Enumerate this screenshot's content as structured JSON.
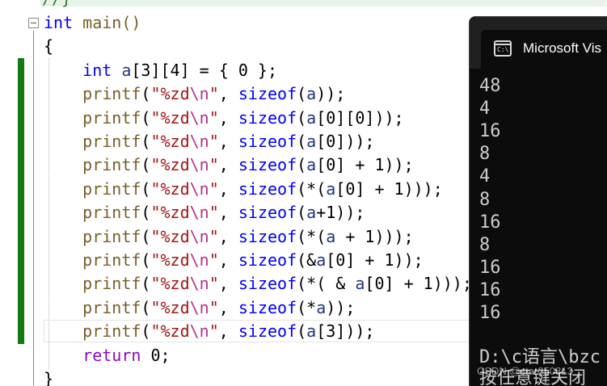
{
  "editor": {
    "top_fragment": "//}",
    "lines": [
      {
        "tokens": [
          {
            "t": "int",
            "c": "kw"
          },
          {
            "t": " main()",
            "c": "fn"
          }
        ]
      },
      {
        "tokens": [
          {
            "t": "{",
            "c": "pl"
          }
        ]
      },
      {
        "tokens": [
          {
            "t": "    ",
            "c": "pl"
          },
          {
            "t": "int",
            "c": "kw"
          },
          {
            "t": " ",
            "c": "pl"
          },
          {
            "t": "a",
            "c": "var"
          },
          {
            "t": "[3][4] = { 0 };",
            "c": "pl"
          }
        ]
      },
      {
        "tokens": [
          {
            "t": "    ",
            "c": "pl"
          },
          {
            "t": "printf",
            "c": "fn"
          },
          {
            "t": "(",
            "c": "pl"
          },
          {
            "t": "\"%zd",
            "c": "str"
          },
          {
            "t": "\\n",
            "c": "esc"
          },
          {
            "t": "\"",
            "c": "str"
          },
          {
            "t": ", ",
            "c": "pl"
          },
          {
            "t": "sizeof",
            "c": "kw"
          },
          {
            "t": "(",
            "c": "pl"
          },
          {
            "t": "a",
            "c": "var"
          },
          {
            "t": "));",
            "c": "pl"
          }
        ]
      },
      {
        "tokens": [
          {
            "t": "    ",
            "c": "pl"
          },
          {
            "t": "printf",
            "c": "fn"
          },
          {
            "t": "(",
            "c": "pl"
          },
          {
            "t": "\"%zd",
            "c": "str"
          },
          {
            "t": "\\n",
            "c": "esc"
          },
          {
            "t": "\"",
            "c": "str"
          },
          {
            "t": ", ",
            "c": "pl"
          },
          {
            "t": "sizeof",
            "c": "kw"
          },
          {
            "t": "(",
            "c": "pl"
          },
          {
            "t": "a",
            "c": "var"
          },
          {
            "t": "[0][0]));",
            "c": "pl"
          }
        ]
      },
      {
        "tokens": [
          {
            "t": "    ",
            "c": "pl"
          },
          {
            "t": "printf",
            "c": "fn"
          },
          {
            "t": "(",
            "c": "pl"
          },
          {
            "t": "\"%zd",
            "c": "str"
          },
          {
            "t": "\\n",
            "c": "esc"
          },
          {
            "t": "\"",
            "c": "str"
          },
          {
            "t": ", ",
            "c": "pl"
          },
          {
            "t": "sizeof",
            "c": "kw"
          },
          {
            "t": "(",
            "c": "pl"
          },
          {
            "t": "a",
            "c": "var"
          },
          {
            "t": "[0]));",
            "c": "pl"
          }
        ]
      },
      {
        "tokens": [
          {
            "t": "    ",
            "c": "pl"
          },
          {
            "t": "printf",
            "c": "fn"
          },
          {
            "t": "(",
            "c": "pl"
          },
          {
            "t": "\"%zd",
            "c": "str"
          },
          {
            "t": "\\n",
            "c": "esc"
          },
          {
            "t": "\"",
            "c": "str"
          },
          {
            "t": ", ",
            "c": "pl"
          },
          {
            "t": "sizeof",
            "c": "kw"
          },
          {
            "t": "(",
            "c": "pl"
          },
          {
            "t": "a",
            "c": "var"
          },
          {
            "t": "[0] + 1));",
            "c": "pl"
          }
        ]
      },
      {
        "tokens": [
          {
            "t": "    ",
            "c": "pl"
          },
          {
            "t": "printf",
            "c": "fn"
          },
          {
            "t": "(",
            "c": "pl"
          },
          {
            "t": "\"%zd",
            "c": "str"
          },
          {
            "t": "\\n",
            "c": "esc"
          },
          {
            "t": "\"",
            "c": "str"
          },
          {
            "t": ", ",
            "c": "pl"
          },
          {
            "t": "sizeof",
            "c": "kw"
          },
          {
            "t": "(*(",
            "c": "pl"
          },
          {
            "t": "a",
            "c": "var"
          },
          {
            "t": "[0] + 1)));",
            "c": "pl"
          }
        ]
      },
      {
        "tokens": [
          {
            "t": "    ",
            "c": "pl"
          },
          {
            "t": "printf",
            "c": "fn"
          },
          {
            "t": "(",
            "c": "pl"
          },
          {
            "t": "\"%zd",
            "c": "str"
          },
          {
            "t": "\\n",
            "c": "esc"
          },
          {
            "t": "\"",
            "c": "str"
          },
          {
            "t": ", ",
            "c": "pl"
          },
          {
            "t": "sizeof",
            "c": "kw"
          },
          {
            "t": "(",
            "c": "pl"
          },
          {
            "t": "a",
            "c": "var"
          },
          {
            "t": "+1));",
            "c": "pl"
          }
        ]
      },
      {
        "tokens": [
          {
            "t": "    ",
            "c": "pl"
          },
          {
            "t": "printf",
            "c": "fn"
          },
          {
            "t": "(",
            "c": "pl"
          },
          {
            "t": "\"%zd",
            "c": "str"
          },
          {
            "t": "\\n",
            "c": "esc"
          },
          {
            "t": "\"",
            "c": "str"
          },
          {
            "t": ", ",
            "c": "pl"
          },
          {
            "t": "sizeof",
            "c": "kw"
          },
          {
            "t": "(*(",
            "c": "pl"
          },
          {
            "t": "a",
            "c": "var"
          },
          {
            "t": " + 1)));",
            "c": "pl"
          }
        ]
      },
      {
        "tokens": [
          {
            "t": "    ",
            "c": "pl"
          },
          {
            "t": "printf",
            "c": "fn"
          },
          {
            "t": "(",
            "c": "pl"
          },
          {
            "t": "\"%zd",
            "c": "str"
          },
          {
            "t": "\\n",
            "c": "esc"
          },
          {
            "t": "\"",
            "c": "str"
          },
          {
            "t": ", ",
            "c": "pl"
          },
          {
            "t": "sizeof",
            "c": "kw"
          },
          {
            "t": "(&",
            "c": "pl"
          },
          {
            "t": "a",
            "c": "var"
          },
          {
            "t": "[0] + 1));",
            "c": "pl"
          }
        ]
      },
      {
        "tokens": [
          {
            "t": "    ",
            "c": "pl"
          },
          {
            "t": "printf",
            "c": "fn"
          },
          {
            "t": "(",
            "c": "pl"
          },
          {
            "t": "\"%zd",
            "c": "str"
          },
          {
            "t": "\\n",
            "c": "esc"
          },
          {
            "t": "\"",
            "c": "str"
          },
          {
            "t": ", ",
            "c": "pl"
          },
          {
            "t": "sizeof",
            "c": "kw"
          },
          {
            "t": "(*( & ",
            "c": "pl"
          },
          {
            "t": "a",
            "c": "var"
          },
          {
            "t": "[0] + 1)));",
            "c": "pl"
          }
        ]
      },
      {
        "tokens": [
          {
            "t": "    ",
            "c": "pl"
          },
          {
            "t": "printf",
            "c": "fn"
          },
          {
            "t": "(",
            "c": "pl"
          },
          {
            "t": "\"%zd",
            "c": "str"
          },
          {
            "t": "\\n",
            "c": "esc"
          },
          {
            "t": "\"",
            "c": "str"
          },
          {
            "t": ", ",
            "c": "pl"
          },
          {
            "t": "sizeof",
            "c": "kw"
          },
          {
            "t": "(*",
            "c": "pl"
          },
          {
            "t": "a",
            "c": "var"
          },
          {
            "t": "));",
            "c": "pl"
          }
        ]
      },
      {
        "tokens": [
          {
            "t": "    ",
            "c": "pl"
          },
          {
            "t": "printf",
            "c": "fn"
          },
          {
            "t": "(",
            "c": "pl"
          },
          {
            "t": "\"%zd",
            "c": "str"
          },
          {
            "t": "\\n",
            "c": "esc"
          },
          {
            "t": "\"",
            "c": "str"
          },
          {
            "t": ", ",
            "c": "pl"
          },
          {
            "t": "sizeof",
            "c": "kw"
          },
          {
            "t": "(",
            "c": "pl"
          },
          {
            "t": "a",
            "c": "var"
          },
          {
            "t": "[3]));",
            "c": "pl"
          }
        ]
      },
      {
        "tokens": [
          {
            "t": "    ",
            "c": "pl"
          },
          {
            "t": "return",
            "c": "ret"
          },
          {
            "t": " 0;",
            "c": "pl"
          }
        ]
      },
      {
        "tokens": [
          {
            "t": "}",
            "c": "pl"
          }
        ]
      }
    ]
  },
  "console": {
    "title": "Microsoft Vis",
    "icon": "terminal-icon",
    "icon_glyph": "C:\\",
    "output": [
      "48",
      "4",
      "16",
      "8",
      "4",
      "8",
      "16",
      "8",
      "16",
      "16",
      "16"
    ],
    "path_fragment": "D:\\c语言\\bzc",
    "prompt_fragment": "按任意键关闭"
  },
  "watermark": "CSDN @star050813",
  "colors": {
    "keyword": "#0000ff",
    "function": "#795e26",
    "string": "#a31515",
    "escape": "#b5338a",
    "variable": "#1f377f",
    "return_keyword": "#8f08c4",
    "change_bar": "#107c10",
    "console_bg": "#0c0c0c",
    "console_text": "#cccccc"
  }
}
